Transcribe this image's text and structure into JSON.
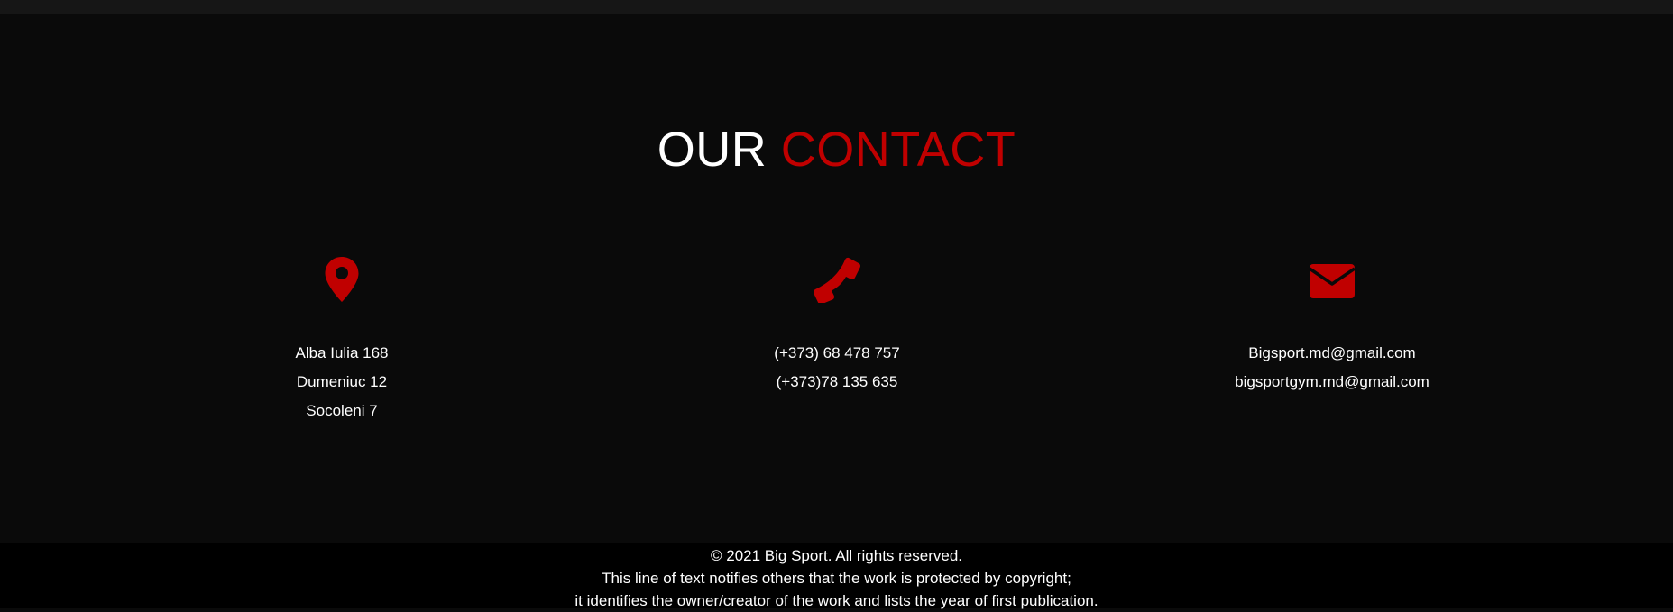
{
  "section": {
    "title_part1": "OUR",
    "title_part2": "CONTACT"
  },
  "address": {
    "icon": "map-pin-icon",
    "lines": [
      "Alba Iulia 168",
      "Dumeniuc 12",
      "Socoleni 7"
    ]
  },
  "phone": {
    "icon": "phone-icon",
    "lines": [
      "(+373) 68 478 757",
      "(+373)78 135 635"
    ]
  },
  "email": {
    "icon": "envelope-icon",
    "lines": [
      "Bigsport.md@gmail.com",
      "bigsportgym.md@gmail.com"
    ]
  },
  "footer": {
    "line1": "© 2021 Big Sport. All rights reserved.",
    "line2": "This line of text notifies others that the work is protected by copyright;",
    "line3": "it identifies the owner/creator of the work and lists the year of first publication."
  },
  "colors": {
    "accent": "#c00000",
    "background": "#0a0a0a",
    "footer_background": "#000000",
    "text": "#ffffff"
  }
}
